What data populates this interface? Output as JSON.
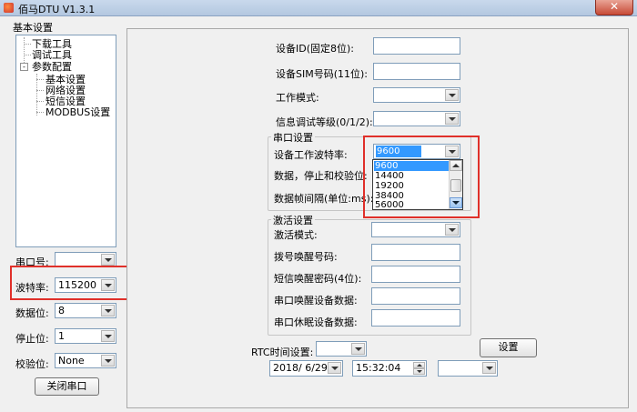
{
  "window": {
    "title": "佰马DTU V1.3.1",
    "close_glyph": "✕"
  },
  "left": {
    "section_label": "基本设置",
    "tree": {
      "download": "下载工具",
      "debug": "调试工具",
      "params": "参数配置",
      "params_expander": "-",
      "basic": "基本设置",
      "network": "网络设置",
      "sms": "短信设置",
      "modbus": "MODBUS设置"
    },
    "port_label": "串口号:",
    "port_value": "",
    "baud_label": "波特率:",
    "baud_value": "115200",
    "databits_label": "数据位:",
    "databits_value": "8",
    "stopbits_label": "停止位:",
    "stopbits_value": "1",
    "parity_label": "校验位:",
    "parity_value": "None",
    "close_port_button": "关闭串口"
  },
  "right": {
    "device_id_label": "设备ID(固定8位):",
    "device_sim_label": "设备SIM号码(11位):",
    "work_mode_label": "工作模式:",
    "debug_level_label": "信息调试等级(0/1/2):",
    "serial_group_title": "串口设置",
    "work_baud_label": "设备工作波特率:",
    "work_baud_value": "9600",
    "data_stop_parity_label": "数据，停止和校验位:",
    "frame_interval_label": "数据帧间隔(单位:ms):",
    "baud_options": [
      "9600",
      "14400",
      "19200",
      "38400",
      "56000"
    ],
    "baud_selected": "9600",
    "activation_group_title": "激活设置",
    "activation_mode_label": "激活模式:",
    "dial_wake_label": "拨号唤醒号码:",
    "sms_wake_label": "短信唤醒密码(4位):",
    "serial_wake_label": "串口唤醒设备数据:",
    "serial_sleep_label": "串口休眠设备数据:",
    "rtc_label": "RTC时间设置:",
    "set_button": "设置",
    "date_value": "2018/ 6/29",
    "time_value": "15:32:04"
  },
  "colors": {
    "highlight_box": "#e0302a",
    "selection": "#3399ff"
  }
}
